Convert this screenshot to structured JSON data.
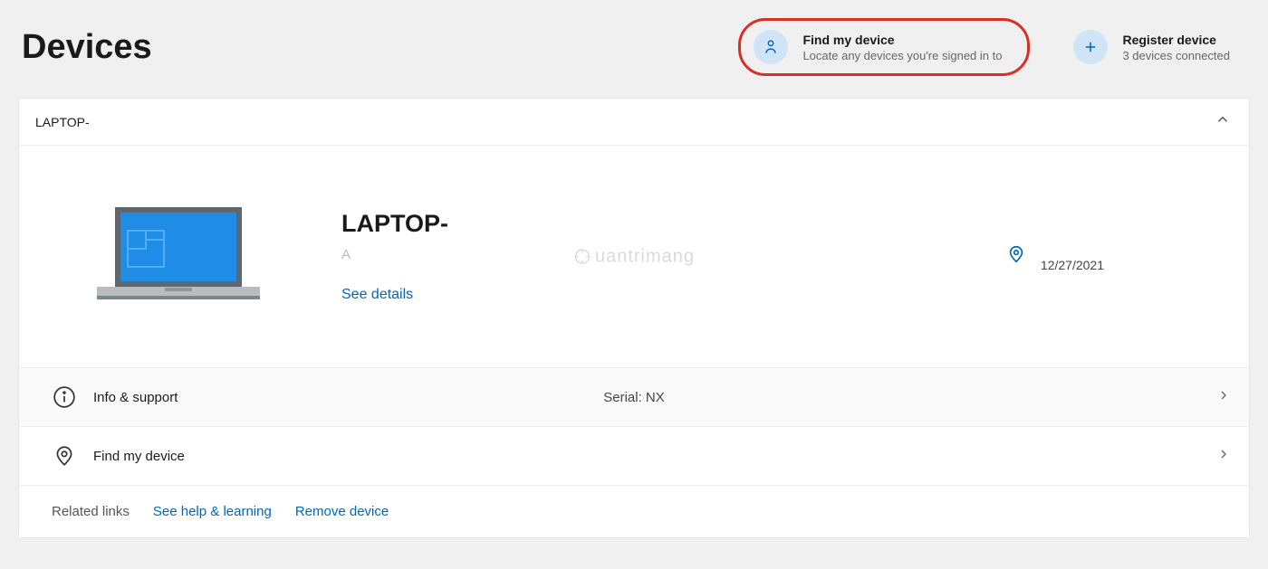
{
  "header": {
    "title": "Devices",
    "find_my_device": {
      "title": "Find my device",
      "subtitle": "Locate any devices you're signed in to"
    },
    "register_device": {
      "title": "Register device",
      "subtitle": "3 devices connected"
    }
  },
  "panel": {
    "header_name": "LAPTOP-",
    "device_name": "LAPTOP-",
    "device_sub": "A",
    "see_details": "See details",
    "location_date": "12/27/2021"
  },
  "rows": {
    "info_support": "Info & support",
    "serial_label": "Serial: NX",
    "find_my_device": "Find my device"
  },
  "related": {
    "label": "Related links",
    "help": "See help & learning",
    "remove": "Remove device"
  },
  "watermark": "uantrimang"
}
